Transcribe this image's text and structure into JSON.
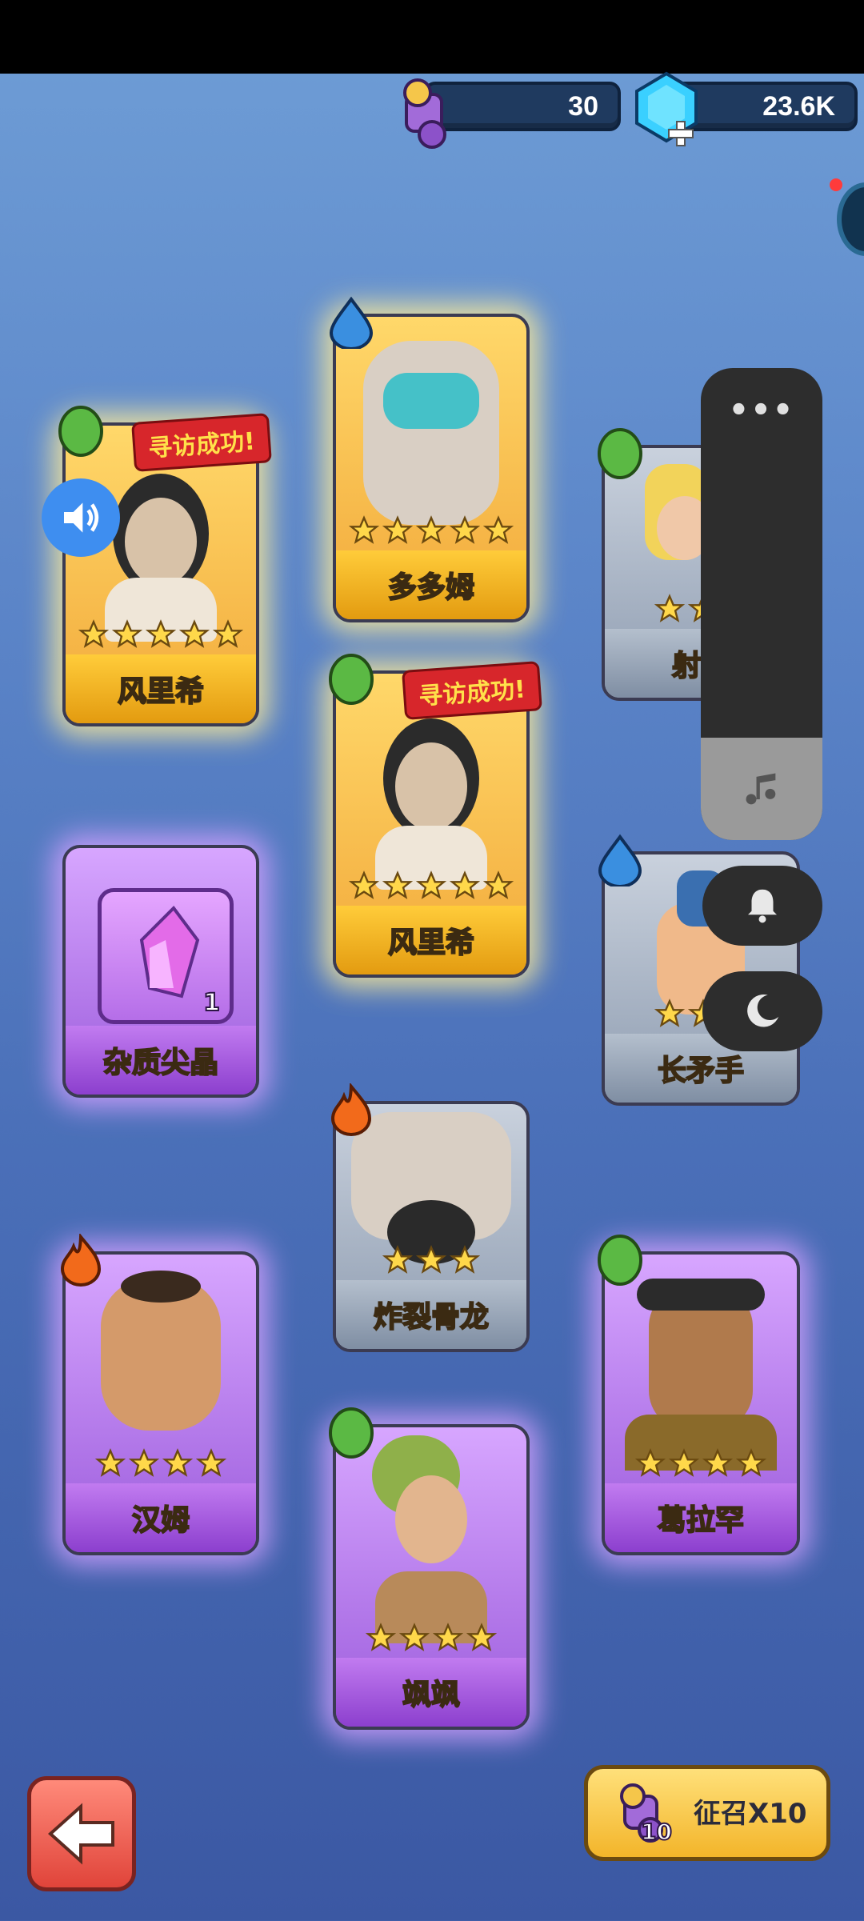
{
  "resources": {
    "scrolls": "30",
    "gems": "23.6K"
  },
  "cards": [
    {
      "id": "c1",
      "name": "风里希",
      "stars": 5,
      "rarity": "gold",
      "element": "leaf",
      "banner": "寻访成功!"
    },
    {
      "id": "c2",
      "name": "多多姆",
      "stars": 5,
      "rarity": "gold",
      "element": "water",
      "banner": ""
    },
    {
      "id": "c3",
      "name": "射",
      "stars": 2,
      "rarity": "gray",
      "element": "leaf",
      "banner": ""
    },
    {
      "id": "c4",
      "name": "风里希",
      "stars": 5,
      "rarity": "gold",
      "element": "leaf",
      "banner": "寻访成功!"
    },
    {
      "id": "c5",
      "name": "杂质尖晶",
      "stars": 0,
      "rarity": "purple",
      "element": "",
      "banner": "",
      "count": "1"
    },
    {
      "id": "c6",
      "name": "长矛手",
      "stars": 2,
      "rarity": "gray",
      "element": "water",
      "banner": ""
    },
    {
      "id": "c7",
      "name": "炸裂骨龙",
      "stars": 3,
      "rarity": "gray",
      "element": "fire",
      "banner": ""
    },
    {
      "id": "c8",
      "name": "汉姆",
      "stars": 4,
      "rarity": "purple",
      "element": "fire",
      "banner": ""
    },
    {
      "id": "c9",
      "name": "葛拉罕",
      "stars": 4,
      "rarity": "purple",
      "element": "leaf",
      "banner": ""
    },
    {
      "id": "c10",
      "name": "飒飒",
      "stars": 4,
      "rarity": "purple",
      "element": "leaf",
      "banner": ""
    }
  ],
  "summon": {
    "label": "征召X10",
    "cost": "10"
  },
  "overlay": {
    "more": "•••"
  },
  "colors": {
    "gold": "#f2a93a",
    "purple": "#9c5cdc",
    "gray": "#8f9db1",
    "leaf": "#5bb944",
    "water": "#3a8fe0",
    "fire": "#f26a1b"
  }
}
